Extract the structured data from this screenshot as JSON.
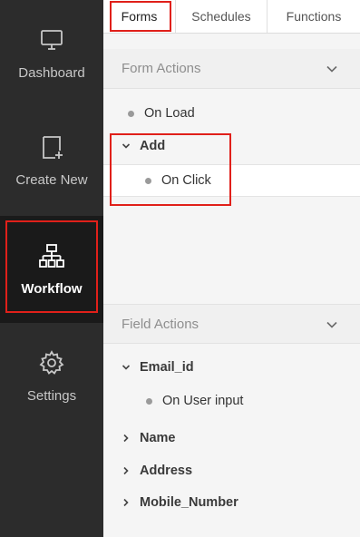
{
  "sidebar": {
    "items": [
      {
        "label": "Dashboard",
        "icon": "monitor-icon"
      },
      {
        "label": "Create New",
        "icon": "add-page-icon"
      },
      {
        "label": "Workflow",
        "icon": "workflow-icon",
        "active": true
      },
      {
        "label": "Settings",
        "icon": "gear-icon"
      }
    ]
  },
  "tabs": [
    {
      "label": "Forms",
      "active": true
    },
    {
      "label": "Schedules"
    },
    {
      "label": "Functions"
    }
  ],
  "form_actions": {
    "title": "Form Actions",
    "on_load": "On Load",
    "add_group": "Add",
    "on_click": "On Click"
  },
  "field_actions": {
    "title": "Field Actions",
    "email_group": "Email_id",
    "on_user_input": "On User input",
    "fields": [
      "Name",
      "Address",
      "Mobile_Number"
    ]
  },
  "colors": {
    "sidebar_bg": "#2c2c2c",
    "sidebar_active_bg": "#1a1a1a",
    "highlight": "#e0201a"
  }
}
